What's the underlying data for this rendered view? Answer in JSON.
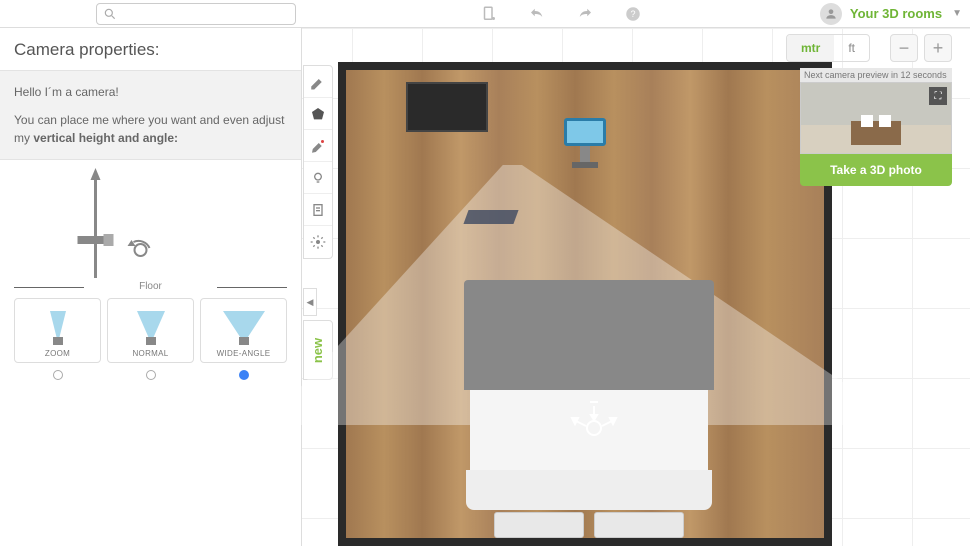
{
  "top": {
    "search_placeholder": "",
    "rooms_link": "Your 3D rooms"
  },
  "sidebar": {
    "title": "Camera properties:",
    "hello": "Hello I´m a camera!",
    "desc_pre": "You can place me where you want and even adjust my ",
    "desc_bold": "vertical height and angle:",
    "floor_label": "Floor",
    "options": [
      {
        "label": "ZOOM"
      },
      {
        "label": "NORMAL"
      },
      {
        "label": "WIDE-ANGLE"
      }
    ]
  },
  "canvas": {
    "unit_mtr": "mtr",
    "unit_ft": "ft",
    "preview_info": "Next camera preview in 12 seconds",
    "take_photo": "Take a 3D photo",
    "new_label": "new"
  }
}
